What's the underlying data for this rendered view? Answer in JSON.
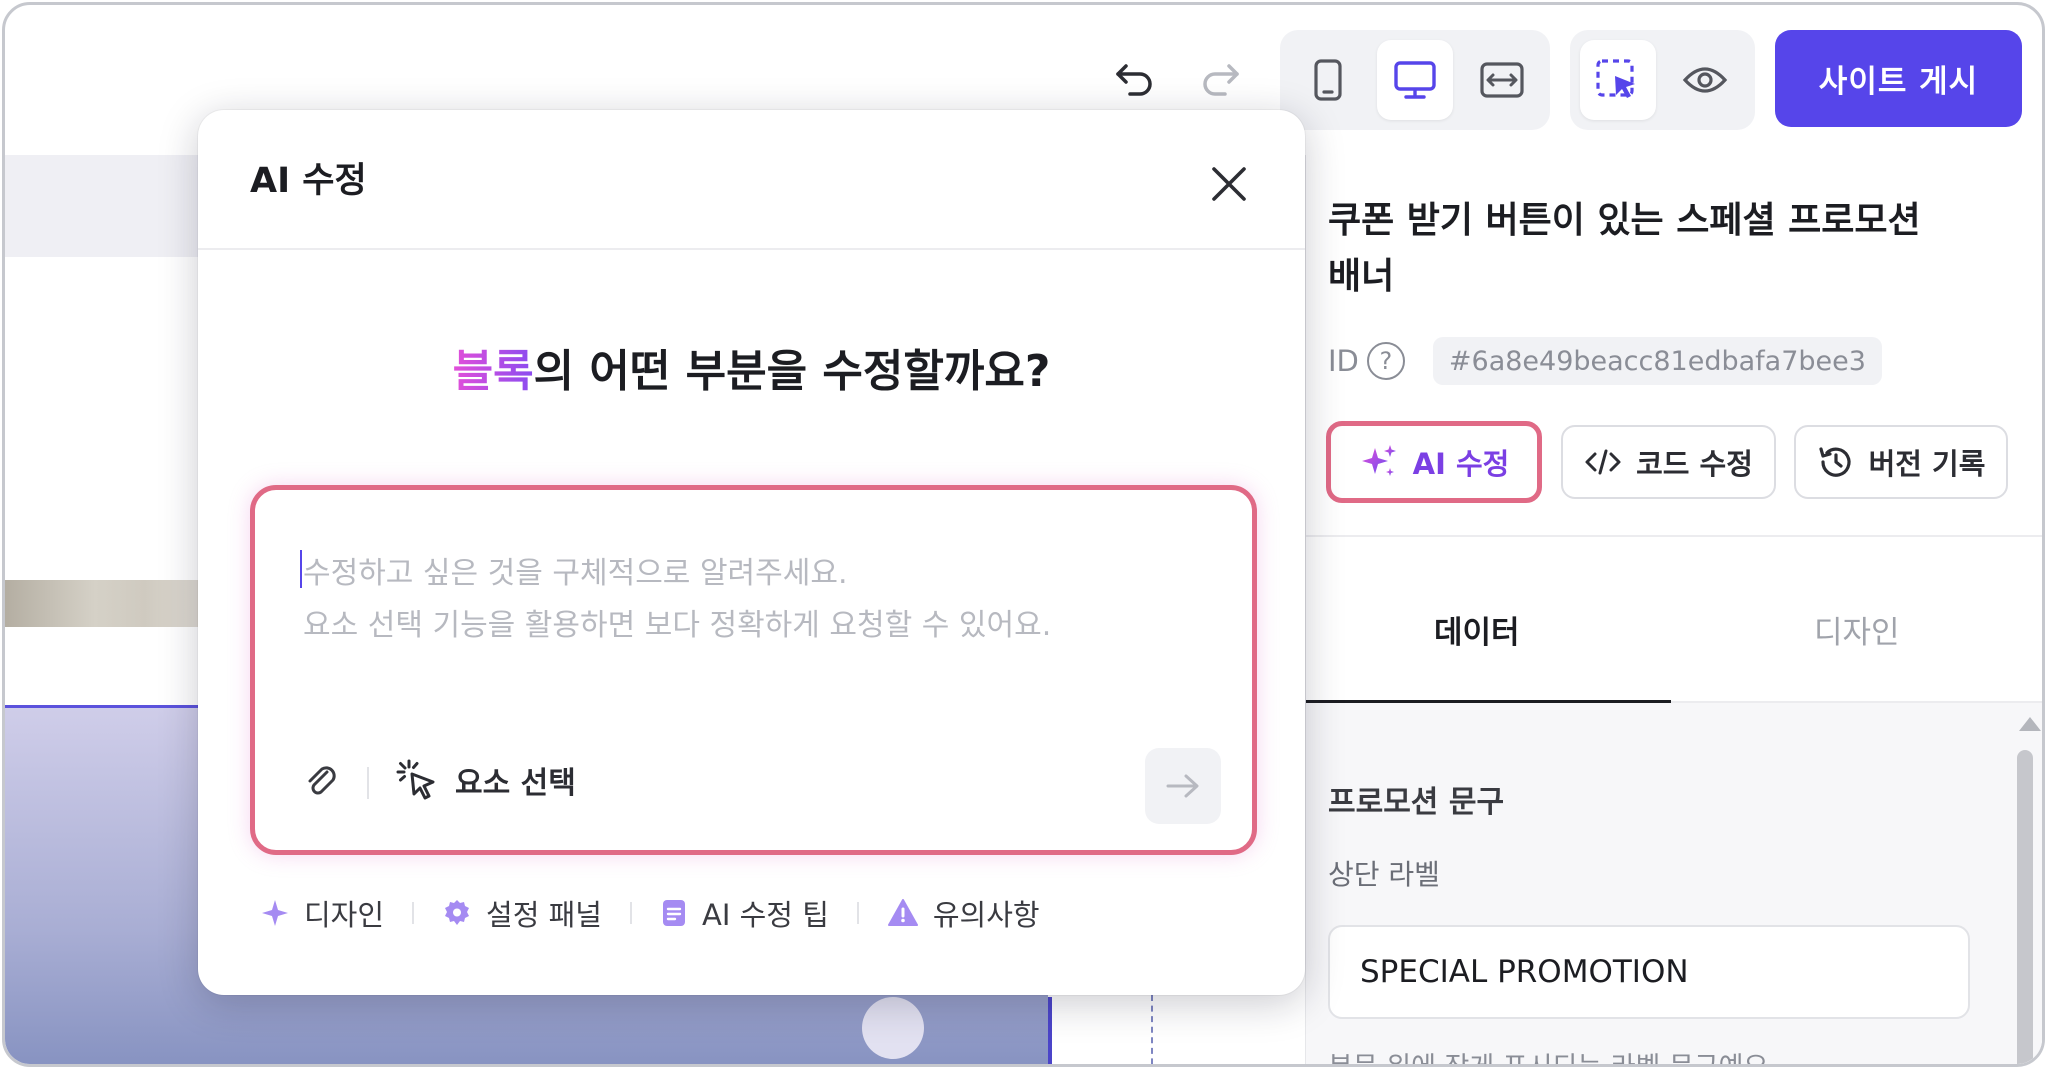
{
  "toolbar": {
    "publish_label": "사이트 게시"
  },
  "panel": {
    "block_title_line1": "쿠폰 받기 버튼이 있는 스페셜 프로모션",
    "block_title_line2": "배너",
    "id_label": "ID",
    "id_help": "?",
    "id_value": "#6a8e49beacc81edbafa7bee3",
    "ai_edit_label": "AI 수정",
    "code_edit_label": "코드 수정",
    "version_label": "버전 기록",
    "tabs": [
      "데이터",
      "디자인"
    ],
    "section_title": "프로모션 문구",
    "field_label": "상단 라벨",
    "field_value": "SPECIAL PROMOTION",
    "field_help": "본문 위에 작게 표시되는 라벨 문구예요."
  },
  "modal": {
    "title": "AI 수정",
    "question_highlight": "블록",
    "question_rest": "의 어떤 부분을 수정할까요?",
    "placeholder_line1": "수정하고 싶은 것을 구체적으로 알려주세요.",
    "placeholder_line2": "요소 선택 기능을 활용하면 보다 정확하게 요청할 수 있어요.",
    "element_select_label": "요소 선택",
    "chips": [
      "디자인",
      "설정 패널",
      "AI 수정 팁",
      "유의사항"
    ]
  },
  "colors": {
    "accent": "#5645ea",
    "highlight_border": "#e06a86",
    "ai_purple": "#7b3fe4"
  },
  "icons": {
    "undo": "undo-icon",
    "redo": "redo-icon",
    "mobile": "mobile-icon",
    "desktop": "desktop-icon",
    "responsive": "responsive-icon",
    "select": "cursor-select-icon",
    "preview": "eye-icon",
    "close": "close-icon",
    "attach": "paperclip-icon",
    "send": "arrow-right-icon"
  }
}
